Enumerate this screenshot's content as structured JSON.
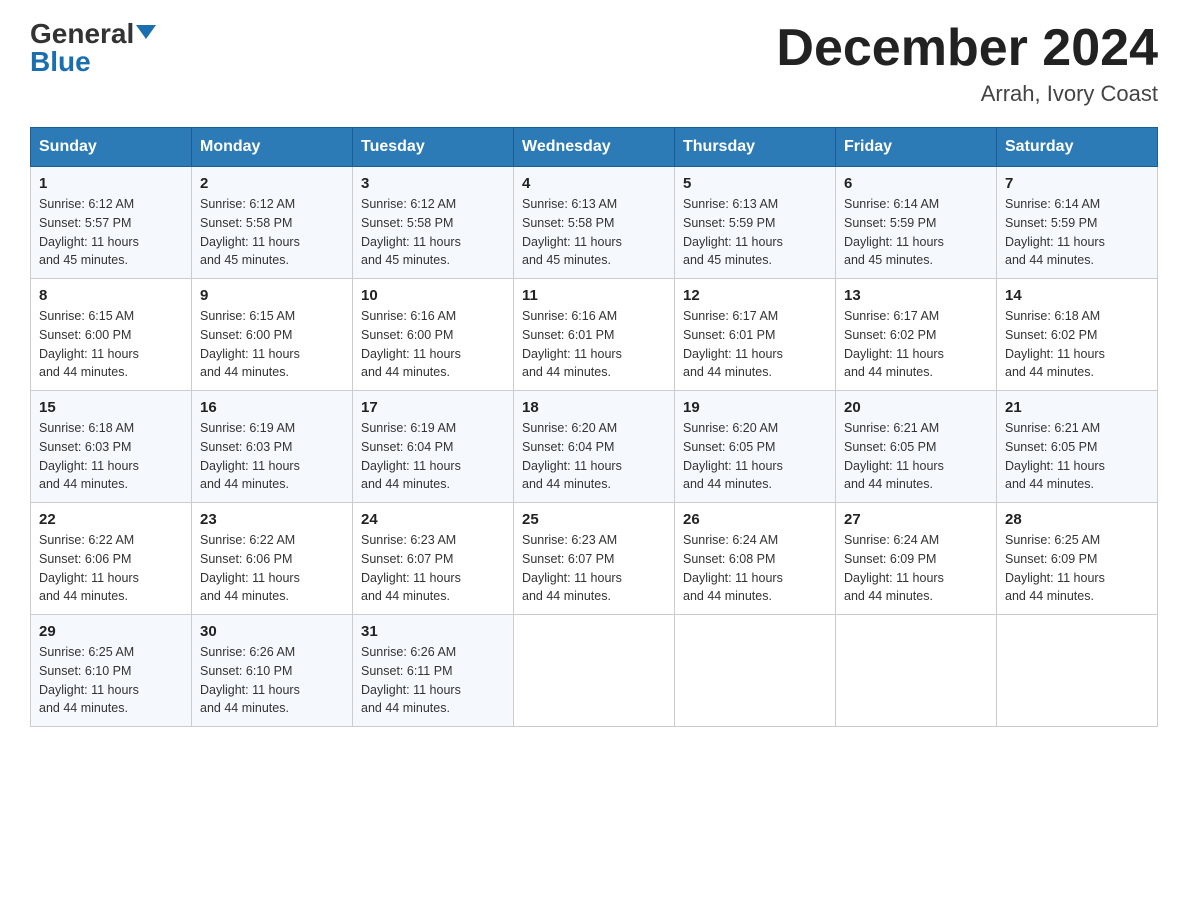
{
  "logo": {
    "general": "General",
    "blue": "Blue"
  },
  "title": "December 2024",
  "subtitle": "Arrah, Ivory Coast",
  "days_of_week": [
    "Sunday",
    "Monday",
    "Tuesday",
    "Wednesday",
    "Thursday",
    "Friday",
    "Saturday"
  ],
  "weeks": [
    [
      {
        "date": "1",
        "info": "Sunrise: 6:12 AM\nSunset: 5:57 PM\nDaylight: 11 hours\nand 45 minutes."
      },
      {
        "date": "2",
        "info": "Sunrise: 6:12 AM\nSunset: 5:58 PM\nDaylight: 11 hours\nand 45 minutes."
      },
      {
        "date": "3",
        "info": "Sunrise: 6:12 AM\nSunset: 5:58 PM\nDaylight: 11 hours\nand 45 minutes."
      },
      {
        "date": "4",
        "info": "Sunrise: 6:13 AM\nSunset: 5:58 PM\nDaylight: 11 hours\nand 45 minutes."
      },
      {
        "date": "5",
        "info": "Sunrise: 6:13 AM\nSunset: 5:59 PM\nDaylight: 11 hours\nand 45 minutes."
      },
      {
        "date": "6",
        "info": "Sunrise: 6:14 AM\nSunset: 5:59 PM\nDaylight: 11 hours\nand 45 minutes."
      },
      {
        "date": "7",
        "info": "Sunrise: 6:14 AM\nSunset: 5:59 PM\nDaylight: 11 hours\nand 44 minutes."
      }
    ],
    [
      {
        "date": "8",
        "info": "Sunrise: 6:15 AM\nSunset: 6:00 PM\nDaylight: 11 hours\nand 44 minutes."
      },
      {
        "date": "9",
        "info": "Sunrise: 6:15 AM\nSunset: 6:00 PM\nDaylight: 11 hours\nand 44 minutes."
      },
      {
        "date": "10",
        "info": "Sunrise: 6:16 AM\nSunset: 6:00 PM\nDaylight: 11 hours\nand 44 minutes."
      },
      {
        "date": "11",
        "info": "Sunrise: 6:16 AM\nSunset: 6:01 PM\nDaylight: 11 hours\nand 44 minutes."
      },
      {
        "date": "12",
        "info": "Sunrise: 6:17 AM\nSunset: 6:01 PM\nDaylight: 11 hours\nand 44 minutes."
      },
      {
        "date": "13",
        "info": "Sunrise: 6:17 AM\nSunset: 6:02 PM\nDaylight: 11 hours\nand 44 minutes."
      },
      {
        "date": "14",
        "info": "Sunrise: 6:18 AM\nSunset: 6:02 PM\nDaylight: 11 hours\nand 44 minutes."
      }
    ],
    [
      {
        "date": "15",
        "info": "Sunrise: 6:18 AM\nSunset: 6:03 PM\nDaylight: 11 hours\nand 44 minutes."
      },
      {
        "date": "16",
        "info": "Sunrise: 6:19 AM\nSunset: 6:03 PM\nDaylight: 11 hours\nand 44 minutes."
      },
      {
        "date": "17",
        "info": "Sunrise: 6:19 AM\nSunset: 6:04 PM\nDaylight: 11 hours\nand 44 minutes."
      },
      {
        "date": "18",
        "info": "Sunrise: 6:20 AM\nSunset: 6:04 PM\nDaylight: 11 hours\nand 44 minutes."
      },
      {
        "date": "19",
        "info": "Sunrise: 6:20 AM\nSunset: 6:05 PM\nDaylight: 11 hours\nand 44 minutes."
      },
      {
        "date": "20",
        "info": "Sunrise: 6:21 AM\nSunset: 6:05 PM\nDaylight: 11 hours\nand 44 minutes."
      },
      {
        "date": "21",
        "info": "Sunrise: 6:21 AM\nSunset: 6:05 PM\nDaylight: 11 hours\nand 44 minutes."
      }
    ],
    [
      {
        "date": "22",
        "info": "Sunrise: 6:22 AM\nSunset: 6:06 PM\nDaylight: 11 hours\nand 44 minutes."
      },
      {
        "date": "23",
        "info": "Sunrise: 6:22 AM\nSunset: 6:06 PM\nDaylight: 11 hours\nand 44 minutes."
      },
      {
        "date": "24",
        "info": "Sunrise: 6:23 AM\nSunset: 6:07 PM\nDaylight: 11 hours\nand 44 minutes."
      },
      {
        "date": "25",
        "info": "Sunrise: 6:23 AM\nSunset: 6:07 PM\nDaylight: 11 hours\nand 44 minutes."
      },
      {
        "date": "26",
        "info": "Sunrise: 6:24 AM\nSunset: 6:08 PM\nDaylight: 11 hours\nand 44 minutes."
      },
      {
        "date": "27",
        "info": "Sunrise: 6:24 AM\nSunset: 6:09 PM\nDaylight: 11 hours\nand 44 minutes."
      },
      {
        "date": "28",
        "info": "Sunrise: 6:25 AM\nSunset: 6:09 PM\nDaylight: 11 hours\nand 44 minutes."
      }
    ],
    [
      {
        "date": "29",
        "info": "Sunrise: 6:25 AM\nSunset: 6:10 PM\nDaylight: 11 hours\nand 44 minutes."
      },
      {
        "date": "30",
        "info": "Sunrise: 6:26 AM\nSunset: 6:10 PM\nDaylight: 11 hours\nand 44 minutes."
      },
      {
        "date": "31",
        "info": "Sunrise: 6:26 AM\nSunset: 6:11 PM\nDaylight: 11 hours\nand 44 minutes."
      },
      {
        "date": "",
        "info": ""
      },
      {
        "date": "",
        "info": ""
      },
      {
        "date": "",
        "info": ""
      },
      {
        "date": "",
        "info": ""
      }
    ]
  ]
}
